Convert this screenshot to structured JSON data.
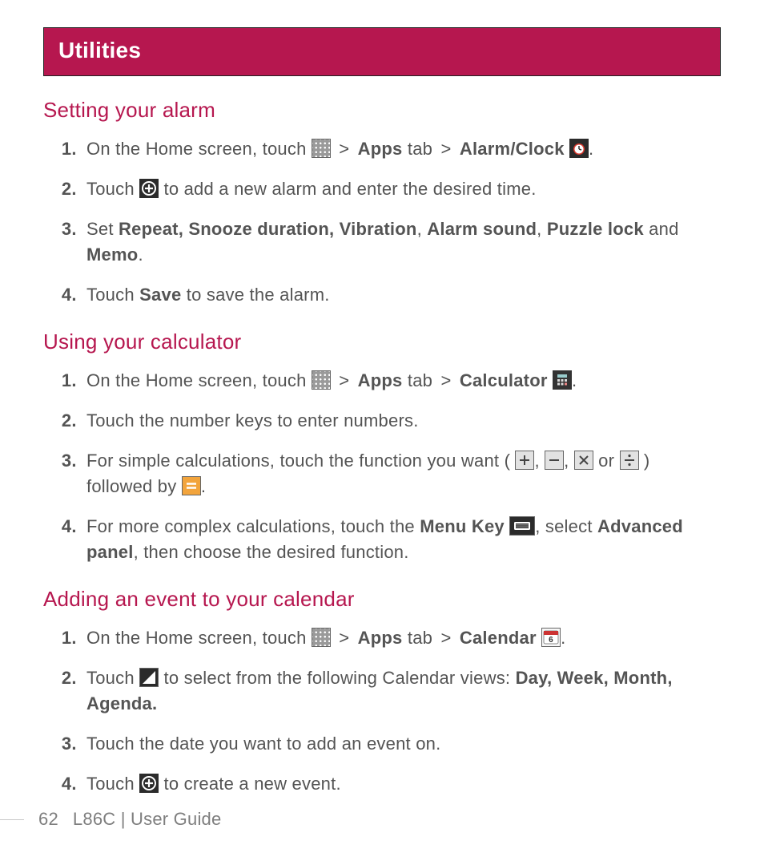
{
  "title": "Utilities",
  "sections": {
    "alarm": {
      "heading": "Setting your alarm",
      "steps": {
        "s1a": "On the Home screen, touch ",
        "s1_apps": "Apps",
        "s1_tab": " tab ",
        "s1_alarm": "Alarm/Clock",
        "s2a": "Touch ",
        "s2b": " to add a new alarm and enter the desired time.",
        "s3a": "Set ",
        "s3_list": "Repeat, Snooze duration, Vibration",
        "s3_c1": ", ",
        "s3_sound": "Alarm sound",
        "s3_c2": ", ",
        "s3_lock": "Puzzle lock",
        "s3_and": " and ",
        "s3_memo": "Memo",
        "s3_p": ".",
        "s4a": "Touch ",
        "s4_save": "Save",
        "s4b": " to save the alarm."
      }
    },
    "calc": {
      "heading": "Using your calculator",
      "steps": {
        "s1a": "On the Home screen, touch ",
        "s1_apps": "Apps",
        "s1_tab": " tab ",
        "s1_calc": "Calculator",
        "s2": "Touch the number keys to enter numbers.",
        "s3a": "For simple calculations, touch the function you want (",
        "s3_or": " or ",
        "s3b": ") followed by ",
        "s4a": "For more complex calculations, touch the ",
        "s4_menu": "Menu Key",
        "s4b": ", select ",
        "s4_adv": "Advanced panel",
        "s4c": ", then choose the desired function."
      }
    },
    "cal": {
      "heading": "Adding an event to your calendar",
      "steps": {
        "s1a": "On the Home screen, touch ",
        "s1_apps": "Apps",
        "s1_tab": " tab ",
        "s1_cal": "Calendar",
        "s2a": "Touch ",
        "s2b": " to select from the following Calendar views: ",
        "s2_views": "Day, Week, Month, Agenda.",
        "s3": "Touch the date you want to add an event on.",
        "s4a": "Touch ",
        "s4b": " to create a new event."
      }
    }
  },
  "gt": ">",
  "comma": ", ",
  "period": ".",
  "footer": {
    "page": "62",
    "text": "L86C  |  User Guide"
  }
}
